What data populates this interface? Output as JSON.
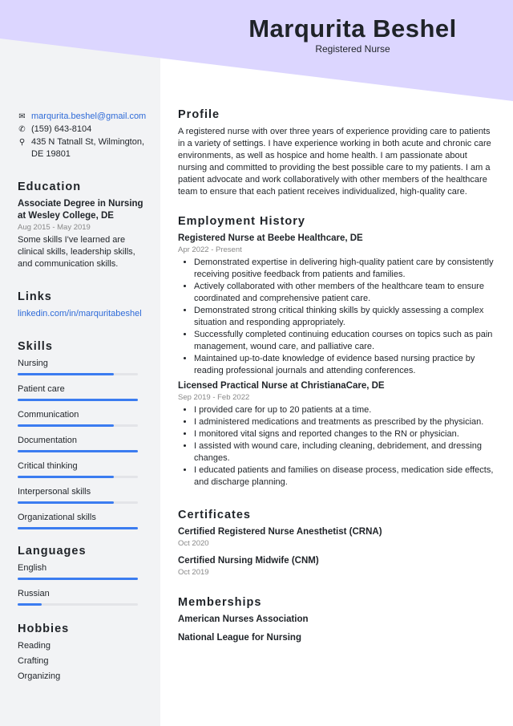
{
  "header": {
    "name": "Marqurita Beshel",
    "title": "Registered Nurse"
  },
  "colors": {
    "header_bg": "#dcd6ff",
    "sidebar_bg": "#f2f3f5",
    "accent": "#3b7cf0"
  },
  "contact": {
    "email": "marqurita.beshel@gmail.com",
    "phone": "(159) 643-8104",
    "address": "435 N Tatnall St, Wilmington, DE 19801"
  },
  "education": {
    "heading": "Education",
    "degree": "Associate Degree in Nursing at Wesley College, DE",
    "dates": "Aug 2015 - May 2019",
    "desc": "Some skills I've learned are clinical skills, leadership skills, and communication skills."
  },
  "links": {
    "heading": "Links",
    "items": [
      "linkedin.com/in/marquritabeshel"
    ]
  },
  "skills": {
    "heading": "Skills",
    "items": [
      {
        "name": "Nursing",
        "level": 80
      },
      {
        "name": "Patient care",
        "level": 100
      },
      {
        "name": "Communication",
        "level": 80
      },
      {
        "name": "Documentation",
        "level": 100
      },
      {
        "name": "Critical thinking",
        "level": 80
      },
      {
        "name": "Interpersonal skills",
        "level": 80
      },
      {
        "name": "Organizational skills",
        "level": 100
      }
    ]
  },
  "languages": {
    "heading": "Languages",
    "items": [
      {
        "name": "English",
        "level": 100
      },
      {
        "name": "Russian",
        "level": 20
      }
    ]
  },
  "hobbies": {
    "heading": "Hobbies",
    "items": [
      "Reading",
      "Crafting",
      "Organizing"
    ]
  },
  "profile": {
    "heading": "Profile",
    "text": "A registered nurse with over three years of experience providing care to patients in a variety of settings. I have experience working in both acute and chronic care environments, as well as hospice and home health. I am passionate about nursing and committed to providing the best possible care to my patients. I am a patient advocate and work collaboratively with other members of the healthcare team to ensure that each patient receives individualized, high-quality care."
  },
  "employment": {
    "heading": "Employment History",
    "jobs": [
      {
        "title": "Registered Nurse at Beebe Healthcare, DE",
        "dates": "Apr 2022 - Present",
        "bullets": [
          "Demonstrated expertise in delivering high-quality patient care by consistently receiving positive feedback from patients and families.",
          "Actively collaborated with other members of the healthcare team to ensure coordinated and comprehensive patient care.",
          "Demonstrated strong critical thinking skills by quickly assessing a complex situation and responding appropriately.",
          "Successfully completed continuing education courses on topics such as pain management, wound care, and palliative care.",
          "Maintained up-to-date knowledge of evidence based nursing practice by reading professional journals and attending conferences."
        ]
      },
      {
        "title": "Licensed Practical Nurse at ChristianaCare, DE",
        "dates": "Sep 2019 - Feb 2022",
        "bullets": [
          "I provided care for up to 20 patients at a time.",
          "I administered medications and treatments as prescribed by the physician.",
          "I monitored vital signs and reported changes to the RN or physician.",
          "I assisted with wound care, including cleaning, debridement, and dressing changes.",
          "I educated patients and families on disease process, medication side effects, and discharge planning."
        ]
      }
    ]
  },
  "certificates": {
    "heading": "Certificates",
    "items": [
      {
        "name": "Certified Registered Nurse Anesthetist (CRNA)",
        "date": "Oct 2020"
      },
      {
        "name": "Certified Nursing Midwife (CNM)",
        "date": "Oct 2019"
      }
    ]
  },
  "memberships": {
    "heading": "Memberships",
    "items": [
      "American Nurses Association",
      "National League for Nursing"
    ]
  }
}
